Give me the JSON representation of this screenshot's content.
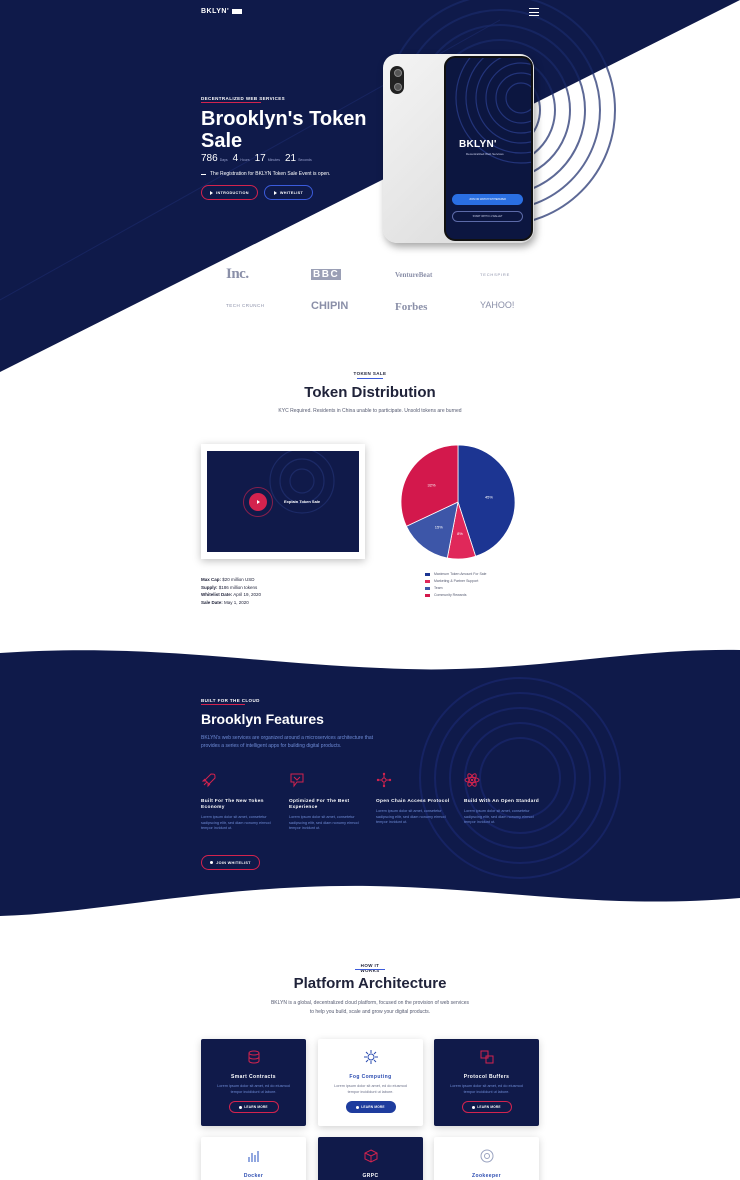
{
  "colors": {
    "navy": "#0f1a4a",
    "accent_red": "#d3234e",
    "accent_blue": "#2a4bb0",
    "muted_blue": "#6e8bd6"
  },
  "header": {
    "logo": "BKLYN'",
    "menu_icon": "hamburger-menu-icon"
  },
  "hero": {
    "tag": "DECENTRALIZED WEB SERVICES",
    "title": "Brooklyn's Token Sale",
    "countdown": [
      {
        "value": "786",
        "label": "Days"
      },
      {
        "value": "4",
        "label": "Hours"
      },
      {
        "value": "17",
        "label": "Minutes"
      },
      {
        "value": "21",
        "label": "Seconds"
      }
    ],
    "note": "The Registration for BKLYN Token Sale Event is open.",
    "btn_intro": "INTRODUCTION",
    "btn_whitelist": "WHITELIST",
    "phone": {
      "logo": "BKLYN'",
      "subtitle": "Decentralized Web Services",
      "btn_primary": "JOIN OR WATCH WHITEPAPER",
      "btn_secondary": "START WITH 0.1 WALLET"
    }
  },
  "press": [
    "Inc.",
    "BBC",
    "VentureBeat",
    "TECHSPIRE",
    "TECH CRUNCH",
    "CHIPIN",
    "Forbes",
    "YAHOO!"
  ],
  "token_sale": {
    "tag": "TOKEN SALE",
    "title": "Token Distribution",
    "subtitle": "KYC Required. Residents in China unable to participate. Unsold tokens are burned",
    "video_label": "Explain Token Sale",
    "facts": [
      {
        "label": "Max Cap:",
        "value": "$20 million USD"
      },
      {
        "label": "Supply:",
        "value": "$186 million tokens"
      },
      {
        "label": "Whitelist Date:",
        "value": "April 19, 2020"
      },
      {
        "label": "Sale Date:",
        "value": "May 1, 2020"
      }
    ]
  },
  "chart_data": {
    "type": "pie",
    "slices": [
      {
        "name": "Maximum Token Amount For Sale",
        "value": 45,
        "label": "45%",
        "color": "#1c3592"
      },
      {
        "name": "Marketing & Partner Support",
        "value": 8,
        "label": "8%",
        "color": "#e0285a"
      },
      {
        "name": "Team",
        "value": 15,
        "label": "15%",
        "color": "#3d56a8"
      },
      {
        "name": "Community Rewards",
        "value": 32,
        "label": "32%",
        "color": "#d3184c"
      }
    ],
    "legend_position": "bottom"
  },
  "features": {
    "tag": "BUILT FOR THE CLOUD",
    "title": "Brooklyn Features",
    "description": "BKLYN's web services are organized around a microservices architecture that provides a series of intelligent apps for building digital products.",
    "items": [
      {
        "icon": "rocket-icon",
        "title": "Built For The New Token Economy",
        "text": "Lorem ipsum dolor sit amet, consetetur sadipscing elitr, sed diam nonumy eirmod tempor invidunt ut."
      },
      {
        "icon": "flag-icon",
        "title": "Optimized For The Best Experience",
        "text": "Lorem ipsum dolor sit amet, consetetur sadipscing elitr, sed diam nonumy eirmod tempor invidunt ut."
      },
      {
        "icon": "network-icon",
        "title": "Open Chain Access Protocol",
        "text": "Lorem ipsum dolor sit amet, consetetur sadipscing elitr, sed diam nonumy eirmod tempor invidunt ut."
      },
      {
        "icon": "atom-icon",
        "title": "Build With An Open Standard",
        "text": "Lorem ipsum dolor sit amet, consetetur sadipscing elitr, sed diam nonumy eirmod tempor invidunt ut."
      }
    ],
    "btn_join": "JOIN WHITELIST"
  },
  "platform": {
    "tag": "HOW IT WORKS",
    "title": "Platform Architecture",
    "description": "BKLYN is a global, decentralized cloud platform, focused on the provision of web services to help you build, scale and grow your digital products.",
    "cards": [
      {
        "icon": "database-icon",
        "title": "Smart Contracts",
        "text": "Lorem ipsum dolor sit amet, ed do eiusmod tempor incididunt ut labore.",
        "btn": "LEARN MORE"
      },
      {
        "icon": "cog-icon",
        "title": "Fog Computing",
        "text": "Lorem ipsum dolor sit amet, ed do eiusmod tempor incididunt ut labore.",
        "btn": "LEARN MORE"
      },
      {
        "icon": "cubes-icon",
        "title": "Protocol Buffers",
        "text": "Lorem ipsum dolor sit amet, ed do eiusmod tempor incididunt ut labore.",
        "btn": "LEARN MORE"
      },
      {
        "icon": "bar-chart-icon",
        "title": "Docker"
      },
      {
        "icon": "cube-icon",
        "title": "GRPC"
      },
      {
        "icon": "gear-icon",
        "title": "Zookeeper"
      }
    ]
  }
}
